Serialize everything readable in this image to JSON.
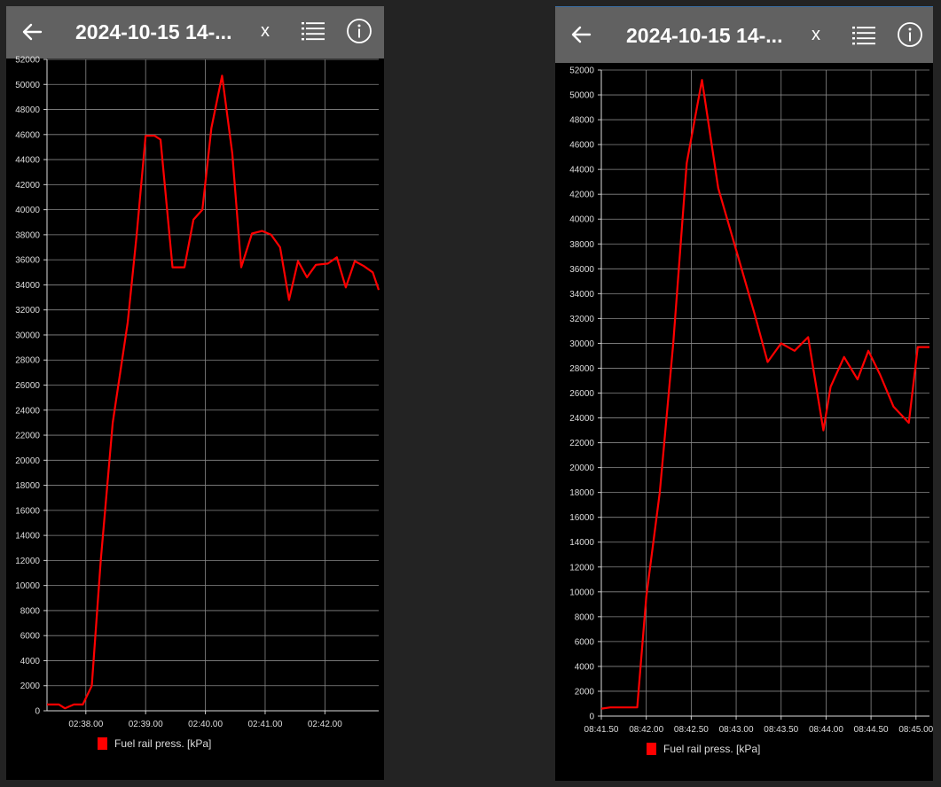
{
  "colors": {
    "series": "#ff0000",
    "grid": "#888888",
    "appbar": "#616161",
    "plot_background": "#000000",
    "text": "#ffffff"
  },
  "panels": [
    {
      "appbar": {
        "title": "2024-10-15 14-...",
        "close_label": "x",
        "icons": [
          "back-arrow-icon",
          "list-icon",
          "info-icon"
        ]
      },
      "legend_label": "Fuel rail press. [kPa]"
    },
    {
      "appbar": {
        "title": "2024-10-15 14-...",
        "close_label": "x",
        "icons": [
          "back-arrow-icon",
          "list-icon",
          "info-icon"
        ]
      },
      "legend_label": "Fuel rail press. [kPa]"
    }
  ],
  "chart_data": [
    {
      "type": "line",
      "title": "",
      "xlabel": "",
      "ylabel": "",
      "grid": true,
      "legend": "bottom-left",
      "ylim": [
        0,
        52000
      ],
      "yticks": [
        0,
        2000,
        4000,
        6000,
        8000,
        10000,
        12000,
        14000,
        16000,
        18000,
        20000,
        22000,
        24000,
        26000,
        28000,
        30000,
        32000,
        34000,
        36000,
        38000,
        40000,
        42000,
        44000,
        46000,
        48000,
        50000,
        52000
      ],
      "xlim": [
        "02:37.35",
        "02:42.90"
      ],
      "xticks": [
        "02:38.00",
        "02:39.00",
        "02:40.00",
        "02:41.00",
        "02:42.00"
      ],
      "series": [
        {
          "name": "Fuel rail press. [kPa]",
          "x": [
            "02:37.35",
            "02:37.55",
            "02:37.65",
            "02:37.80",
            "02:37.95",
            "02:38.10",
            "02:38.25",
            "02:38.45",
            "02:38.70",
            "02:38.85",
            "02:39.00",
            "02:39.15",
            "02:39.25",
            "02:39.45",
            "02:39.65",
            "02:39.80",
            "02:39.95",
            "02:40.10",
            "02:40.28",
            "02:40.45",
            "02:40.60",
            "02:40.78",
            "02:40.95",
            "02:41.10",
            "02:41.25",
            "02:41.40",
            "02:41.55",
            "02:41.70",
            "02:41.85",
            "02:42.05",
            "02:42.20",
            "02:42.35",
            "02:42.50",
            "02:42.65",
            "02:42.80",
            "02:42.90"
          ],
          "y": [
            500,
            500,
            200,
            500,
            500,
            2000,
            12000,
            23000,
            31000,
            38000,
            45900,
            45900,
            45600,
            35400,
            35400,
            39200,
            40000,
            46500,
            50700,
            44500,
            35400,
            38100,
            38300,
            38000,
            37000,
            32800,
            35900,
            34600,
            35600,
            35700,
            36200,
            33800,
            35900,
            35500,
            35000,
            33600
          ]
        }
      ]
    },
    {
      "type": "line",
      "title": "",
      "xlabel": "",
      "ylabel": "",
      "grid": true,
      "legend": "bottom-left",
      "ylim": [
        0,
        52000
      ],
      "yticks": [
        0,
        2000,
        4000,
        6000,
        8000,
        10000,
        12000,
        14000,
        16000,
        18000,
        20000,
        22000,
        24000,
        26000,
        28000,
        30000,
        32000,
        34000,
        36000,
        38000,
        40000,
        42000,
        44000,
        46000,
        48000,
        50000,
        52000
      ],
      "xlim": [
        "08:41.50",
        "08:45.15"
      ],
      "xticks": [
        "08:41.50",
        "08:42.00",
        "08:42.50",
        "08:43.00",
        "08:43.50",
        "08:44.00",
        "08:44.50",
        "08:45.00"
      ],
      "series": [
        {
          "name": "Fuel rail press. [kPa]",
          "x": [
            "08:41.50",
            "08:41.60",
            "08:41.90",
            "08:42.00",
            "08:42.15",
            "08:42.30",
            "08:42.45",
            "08:42.62",
            "08:42.80",
            "08:43.00",
            "08:43.20",
            "08:43.35",
            "08:43.50",
            "08:43.65",
            "08:43.80",
            "08:43.97",
            "08:44.05",
            "08:44.20",
            "08:44.35",
            "08:44.47",
            "08:44.60",
            "08:44.75",
            "08:44.92",
            "08:45.02",
            "08:45.15"
          ],
          "y": [
            600,
            700,
            700,
            9600,
            18000,
            30000,
            44500,
            51200,
            42500,
            37500,
            32500,
            28500,
            30000,
            29400,
            30500,
            23000,
            26500,
            28900,
            27100,
            29400,
            27500,
            24900,
            23600,
            29700,
            29700
          ]
        }
      ]
    }
  ]
}
